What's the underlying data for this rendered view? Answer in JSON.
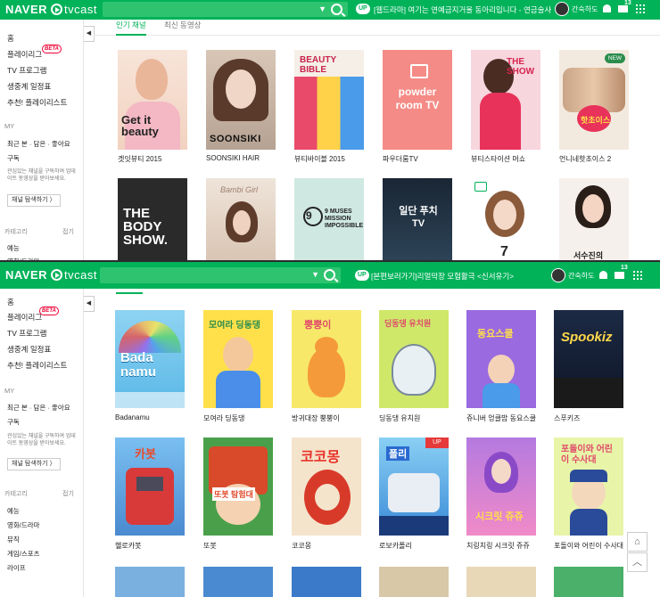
{
  "brand": {
    "naver": "NAVER",
    "tvcast": "tvcast"
  },
  "colors": {
    "brand_green": "#01b259",
    "beta_red": "#e60033",
    "new_badge": "#2c8d4d",
    "up_red": "#e63a3a"
  },
  "icons": {
    "search": "search-icon",
    "bell": "bell-icon",
    "mail": "mail-icon",
    "apps": "grid-icon",
    "collapse": "chevron-left-icon",
    "home": "home-icon",
    "top": "chevron-up-icon"
  },
  "shot1": {
    "notice_badge": "UP",
    "notice": "[웹드라마] 여기는 연예금지거울 동아리입니다 - 연금술사",
    "user": "간숙하도",
    "mail_count": "13",
    "tabs": [
      "인기 채널",
      "최신 동영상"
    ],
    "sidebar": {
      "menu": [
        "홈",
        "플레이리그",
        "TV 프로그램",
        "생중계 일정표",
        "추천! 플레이리스트"
      ],
      "beta": "BETA",
      "my_label": "MY",
      "my_links": "최근 본 · 담은 · 좋아요",
      "subscribe": "구독",
      "desc": "관심있는 채널을 구독하여 업데이트 동영상을 받아보세요.",
      "explore": "채널 탐색하기 〉",
      "category_label": "카테고리",
      "fold": "접기",
      "categories": [
        "예능",
        "영화/드라마"
      ]
    },
    "row1": [
      {
        "caption": "겟잇뷰티 2015",
        "art": "Get it beauty"
      },
      {
        "caption": "SOONSIKI HAIR",
        "art": "SOONSIKI"
      },
      {
        "caption": "뷰티바이블 2015",
        "art": "BEAUTY BIBLE"
      },
      {
        "caption": "파우더룸TV",
        "art": "powder room TV"
      },
      {
        "caption": "뷰티스타이션 머쇼",
        "art": "THE SHOW"
      },
      {
        "caption": "언니네핫초이스 2",
        "art": "핫초이스",
        "badge": "NEW"
      }
    ],
    "row2": [
      {
        "art": "THE BODY SHOW."
      },
      {
        "art": "Bambi Girl"
      },
      {
        "art": "9 MUSES MISSION IMPOSSIBLE"
      },
      {
        "art": "일단 푸치 TV"
      },
      {
        "art": "7"
      },
      {
        "art": "서수진의"
      }
    ]
  },
  "shot2": {
    "notice_badge": "UP",
    "notice": "[본편보러가기]리얼막장 모험활극 <신서유기>",
    "user": "간숙하도",
    "mail_count": "13",
    "sidebar": {
      "menu": [
        "홈",
        "플레이리그",
        "TV 프로그램",
        "생중계 일정표",
        "추천! 플레이리스트"
      ],
      "beta": "BETA",
      "my_label": "MY",
      "my_links": "최근 본 · 담은 · 좋아요",
      "subscribe": "구독",
      "desc": "관심있는 채널을 구독하여 업데이트 동영상을 받아보세요.",
      "explore": "채널 탐색하기 〉",
      "category_label": "카테고리",
      "fold": "접기",
      "categories": [
        "예능",
        "영화/드라마",
        "뮤직",
        "게임/스포츠",
        "라이프"
      ]
    },
    "row1": [
      {
        "caption": "Badanamu",
        "art": "Bada namu"
      },
      {
        "caption": "모여라 딩동댕",
        "art": "모여라 딩동댕"
      },
      {
        "caption": "방귀대장 뿡뿡이",
        "art": "뿡뿡이"
      },
      {
        "caption": "딩동댕 유치원",
        "art": "딩동댕 유치원"
      },
      {
        "caption": "쥬니버 엉클밥 동요스쿨",
        "art": "동요스쿨"
      },
      {
        "caption": "스푸키즈",
        "art": "Spookiz"
      }
    ],
    "row2": [
      {
        "caption": "헬로카봇",
        "art": "카봇"
      },
      {
        "caption": "또봇",
        "art": "또봇 탐험대"
      },
      {
        "caption": "코코몽",
        "art": "코코몽"
      },
      {
        "caption": "로보카폴리",
        "art": "폴리",
        "badge": "UP"
      },
      {
        "caption": "치링치링 시크릿 쥬쥬",
        "art": "시크릿 쥬쥬"
      },
      {
        "caption": "포돌이와 어린이 수사대",
        "art": "포돌이와 어린이 수사대"
      }
    ]
  }
}
